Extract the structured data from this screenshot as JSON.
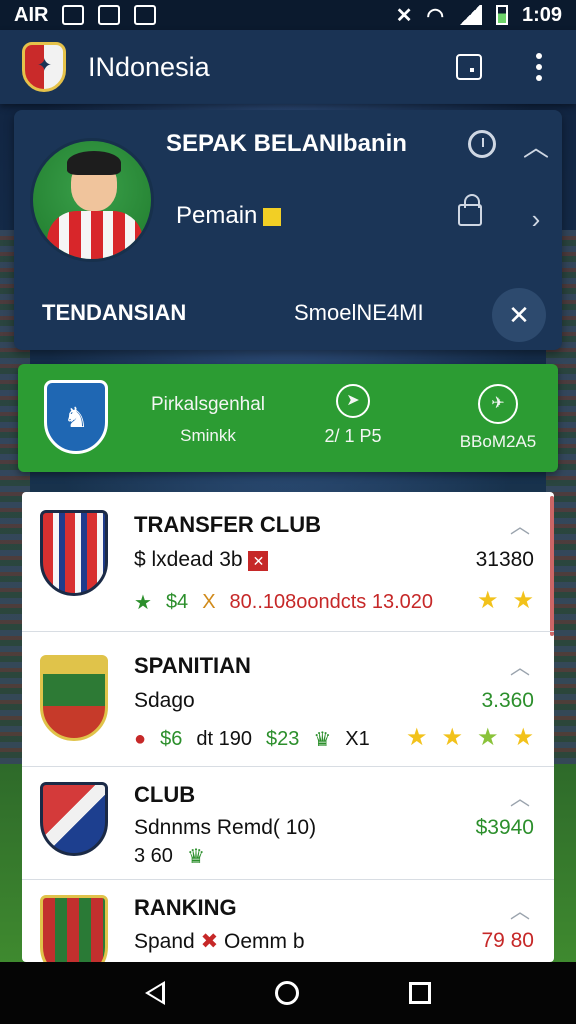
{
  "status_bar": {
    "left_text": "AIR",
    "time": "1:09"
  },
  "app_bar": {
    "title": "INdonesia"
  },
  "profile": {
    "name": "SEPAK BELANIbanin",
    "role": "Pemain",
    "label_left": "TENDANSIAN",
    "label_mid": "SmoelNE4MI"
  },
  "stats": {
    "stat1_line1": "Pirkalsgenhal",
    "stat1_line2": "Sminkk",
    "stat2": "2/ 1 P5",
    "stat3": "BBoM2A5"
  },
  "list": [
    {
      "title": "TRANSFER CLUB",
      "sub": "$ lxdead 3b",
      "value": "31380",
      "meta": [
        "$4",
        "X",
        "80..108oondcts 13.020"
      ]
    },
    {
      "title": "SPANITIAN",
      "sub": "Sdago",
      "value": "3.360",
      "meta": [
        "$6",
        "dt 190",
        "$23",
        "X1"
      ]
    },
    {
      "title": "CLUB",
      "sub": "Sdnnms Remd( 10)",
      "sub2": "3 60",
      "value": "$3940"
    },
    {
      "title": "RANKING",
      "sub": "Spand",
      "sub_extra": "Oemm b",
      "value": "79 80"
    }
  ]
}
